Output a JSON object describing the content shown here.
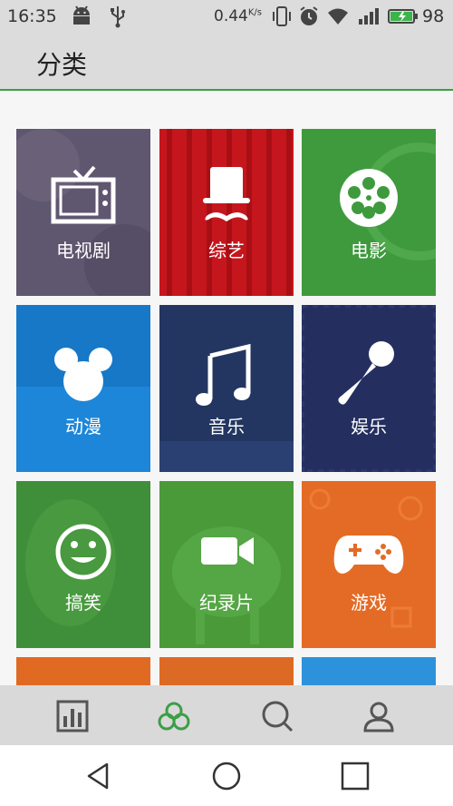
{
  "status_bar": {
    "time": "16:35",
    "network_speed": "0.44",
    "network_unit": "K/s",
    "battery_percent": "98",
    "icons": [
      "android-icon",
      "usb-icon",
      "vibrate-icon",
      "alarm-icon",
      "wifi-icon",
      "signal-icon",
      "battery-icon"
    ]
  },
  "header": {
    "title": "分类"
  },
  "categories": [
    {
      "label": "电视剧",
      "icon": "tv-icon",
      "color": "#5f5670"
    },
    {
      "label": "综艺",
      "icon": "top-hat-mustache-icon",
      "color": "#c6161d"
    },
    {
      "label": "电影",
      "icon": "film-reel-icon",
      "color": "#3f9a3e"
    },
    {
      "label": "动漫",
      "icon": "mouse-ears-icon",
      "color": "#1d86d8"
    },
    {
      "label": "音乐",
      "icon": "music-note-icon",
      "color": "#233662"
    },
    {
      "label": "娱乐",
      "icon": "microphone-icon",
      "color": "#242f60"
    },
    {
      "label": "搞笑",
      "icon": "smiley-icon",
      "color": "#3f8f3a"
    },
    {
      "label": "纪录片",
      "icon": "video-camera-icon",
      "color": "#4a9a3a"
    },
    {
      "label": "游戏",
      "icon": "gamepad-icon",
      "color": "#e46b25"
    },
    {
      "label": "",
      "icon": "",
      "color": "#e06a22"
    },
    {
      "label": "",
      "icon": "",
      "color": "#dd6a24"
    },
    {
      "label": "",
      "icon": "",
      "color": "#2d92dc"
    }
  ],
  "tab_bar": {
    "items": [
      {
        "name": "tab-chart",
        "icon": "bar-chart-icon"
      },
      {
        "name": "tab-category",
        "icon": "three-circles-icon",
        "active": true
      },
      {
        "name": "tab-search",
        "icon": "search-icon"
      },
      {
        "name": "tab-profile",
        "icon": "person-icon"
      }
    ],
    "active_color": "#3c9e46",
    "inactive_color": "#555555"
  },
  "nav_bar": {
    "items": [
      "back-icon",
      "home-icon",
      "recents-icon"
    ]
  }
}
